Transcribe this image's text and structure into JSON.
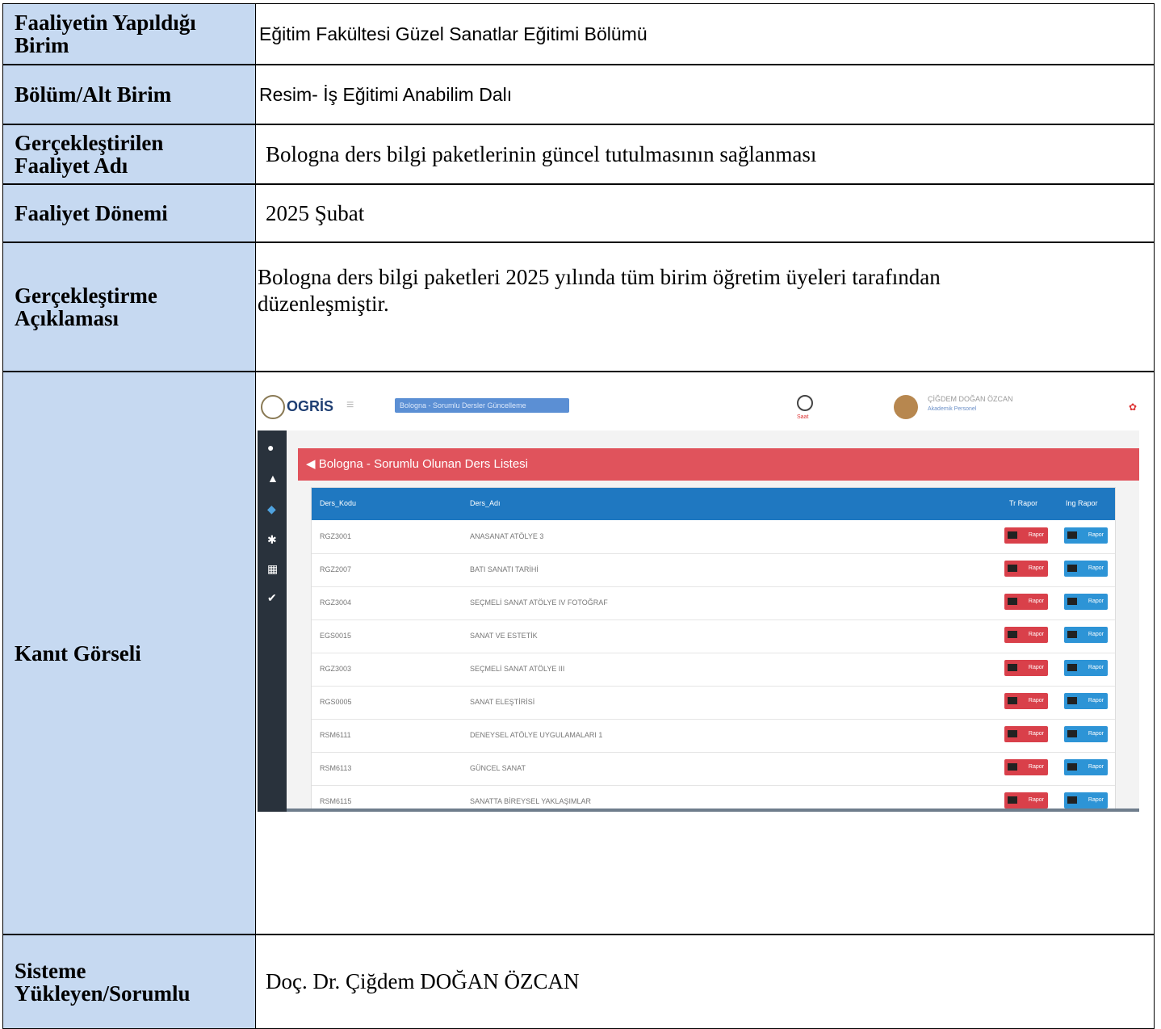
{
  "rows": [
    {
      "label_lines": [
        "Faaliyetin Yapıldığı",
        "Birim"
      ],
      "value": "Eğitim Fakültesi Güzel Sanatlar Eğitimi Bölümü"
    },
    {
      "label_lines": [
        "Bölüm/Alt Birim"
      ],
      "value": "Resim- İş Eğitimi Anabilim Dalı"
    },
    {
      "label_lines": [
        "Gerçekleştirilen",
        "Faaliyet Adı"
      ],
      "value": "Bologna ders bilgi paketlerinin güncel tutulmasının sağlanması"
    },
    {
      "label_lines": [
        "Faaliyet Dönemi"
      ],
      "value": "2025 Şubat"
    },
    {
      "label_lines": [
        "Gerçekleştirme",
        "Açıklaması"
      ],
      "value_lines": [
        "Bologna ders bilgi paketleri 2025 yılında tüm birim öğretim üyeleri tarafından",
        "düzenleşmiştir."
      ]
    },
    {
      "label_lines": [
        "Kanıt Görseli"
      ]
    },
    {
      "label_lines": [
        "Sisteme",
        "Yükleyen/Sorumlu"
      ],
      "value": "Doç. Dr. Çiğdem DOĞAN ÖZCAN"
    }
  ],
  "evidence_screenshot": {
    "logo": "OGRİS",
    "breadcrumb": "Bologna - Sorumlu Dersler Güncelleme",
    "clock_label": "Saat",
    "user_name": "ÇİĞDEM DOĞAN ÖZCAN",
    "user_role": "Akademik Personel",
    "panel_title": "◀ Bologna - Sorumlu Olunan Ders Listesi",
    "columns": [
      "Ders_Kodu",
      "Ders_Adı",
      "Tr Rapor",
      "Ing Rapor"
    ],
    "button_label": "Rapor",
    "courses": [
      {
        "code": "RGZ3001",
        "name": "ANASANAT ATÖLYE 3"
      },
      {
        "code": "RGZ2007",
        "name": "BATI SANATI TARİHİ"
      },
      {
        "code": "RGZ3004",
        "name": "SEÇMELİ SANAT ATÖLYE IV FOTOĞRAF"
      },
      {
        "code": "EGS0015",
        "name": "SANAT VE ESTETİK"
      },
      {
        "code": "RGZ3003",
        "name": "SEÇMELİ SANAT ATÖLYE III"
      },
      {
        "code": "RGS0005",
        "name": "SANAT ELEŞTİRİSİ"
      },
      {
        "code": "RSM6111",
        "name": "DENEYSEL ATÖLYE UYGULAMALARI 1"
      },
      {
        "code": "RSM6113",
        "name": "GÜNCEL SANAT"
      },
      {
        "code": "RSM6115",
        "name": "SANATTA BİREYSEL YAKLAŞIMLAR"
      }
    ],
    "colors": {
      "sidebar": "#29323c",
      "panel": "#e0535c",
      "table_header": "#1f78c1",
      "tr_button": "#d9404a",
      "ing_button": "#2d94d6"
    }
  }
}
